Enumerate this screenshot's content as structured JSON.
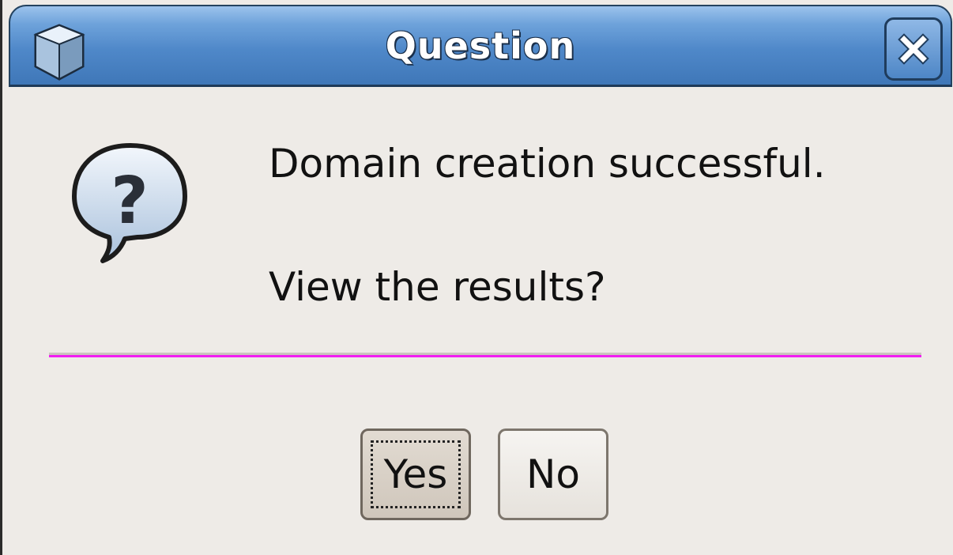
{
  "window": {
    "title": "Question",
    "app_icon": "cube-icon",
    "close_icon": "close-icon"
  },
  "dialog": {
    "icon": "question-icon",
    "message_line1": "Domain creation successful.",
    "message_line2": "View the results?"
  },
  "buttons": {
    "yes_label": "Yes",
    "no_label": "No"
  },
  "colors": {
    "titlebar": "#4f88c9",
    "background": "#eeebe7",
    "separator_accent": "#f21ef2"
  }
}
